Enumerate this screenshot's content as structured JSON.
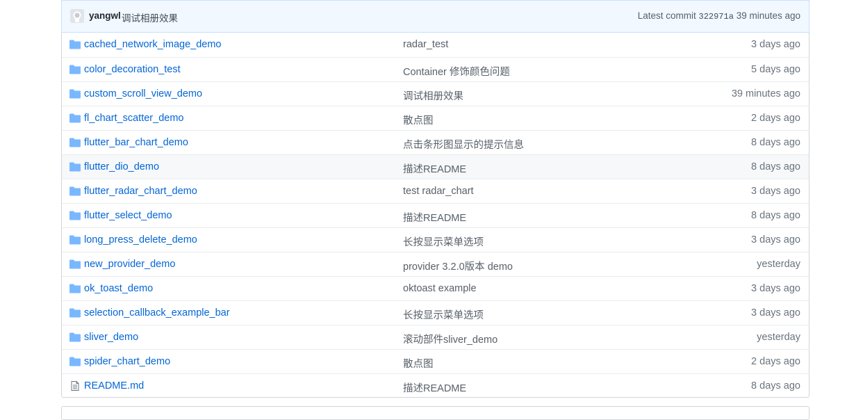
{
  "commit": {
    "author": "yangwl",
    "message": "调试相册效果",
    "latest_label": "Latest commit",
    "sha": "322971a",
    "time": "39 minutes ago"
  },
  "files": [
    {
      "name": "cached_network_image_demo",
      "type": "folder",
      "message": "radar_test",
      "age": "3 days ago"
    },
    {
      "name": "color_decoration_test",
      "type": "folder",
      "message": "Container 修饰颜色问题",
      "age": "5 days ago"
    },
    {
      "name": "custom_scroll_view_demo",
      "type": "folder",
      "message": "调试相册效果",
      "age": "39 minutes ago"
    },
    {
      "name": "fl_chart_scatter_demo",
      "type": "folder",
      "message": "散点图",
      "age": "2 days ago"
    },
    {
      "name": "flutter_bar_chart_demo",
      "type": "folder",
      "message": "点击条形图显示的提示信息",
      "age": "8 days ago"
    },
    {
      "name": "flutter_dio_demo",
      "type": "folder",
      "message": "描述README",
      "age": "8 days ago"
    },
    {
      "name": "flutter_radar_chart_demo",
      "type": "folder",
      "message": "test radar_chart",
      "age": "3 days ago"
    },
    {
      "name": "flutter_select_demo",
      "type": "folder",
      "message": "描述README",
      "age": "8 days ago"
    },
    {
      "name": "long_press_delete_demo",
      "type": "folder",
      "message": "长按显示菜单选项",
      "age": "3 days ago"
    },
    {
      "name": "new_provider_demo",
      "type": "folder",
      "message": "provider 3.2.0版本 demo",
      "age": "yesterday"
    },
    {
      "name": "ok_toast_demo",
      "type": "folder",
      "message": "oktoast example",
      "age": "3 days ago"
    },
    {
      "name": "selection_callback_example_bar",
      "type": "folder",
      "message": "长按显示菜单选项",
      "age": "3 days ago"
    },
    {
      "name": "sliver_demo",
      "type": "folder",
      "message": "滚动部件sliver_demo",
      "age": "yesterday"
    },
    {
      "name": "spider_chart_demo",
      "type": "folder",
      "message": "散点图",
      "age": "2 days ago"
    },
    {
      "name": "README.md",
      "type": "file",
      "message": "描述README",
      "age": "8 days ago"
    }
  ],
  "colors": {
    "link": "#0366d6",
    "folder_icon": "#79b8ff",
    "file_icon": "#6a737d",
    "commit_bar_bg": "#f1f8ff",
    "hover_row_bg": "#f6f8fa"
  },
  "hovered_row": "flutter_dio_demo"
}
